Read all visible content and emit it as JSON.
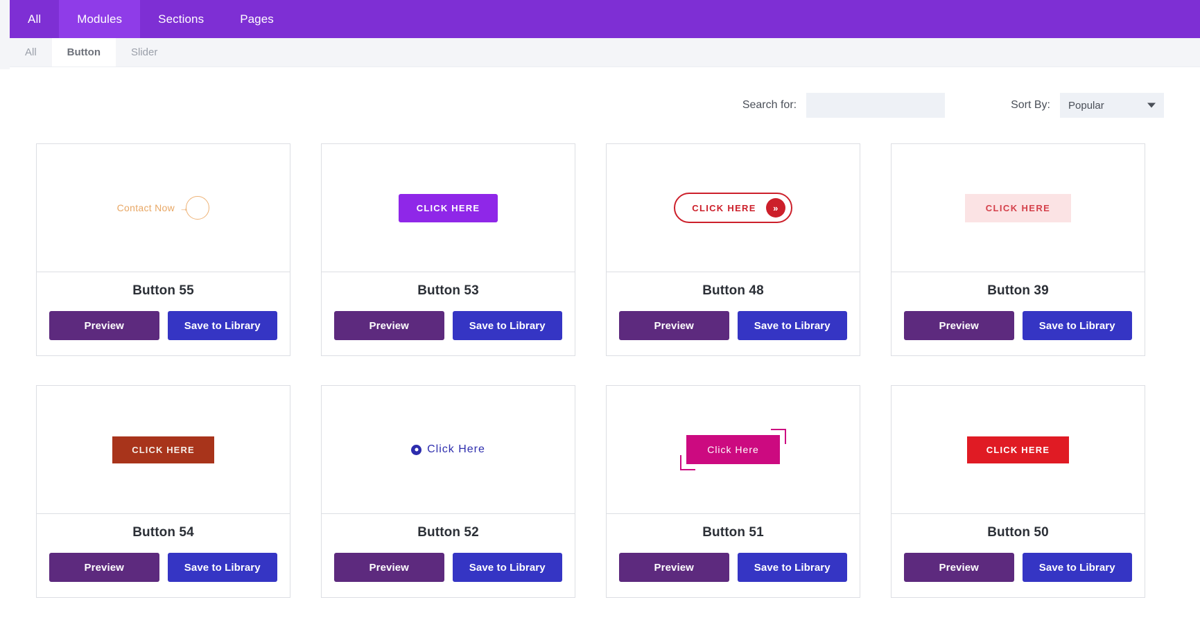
{
  "primary_nav": {
    "items": [
      {
        "label": "All",
        "active": false
      },
      {
        "label": "Modules",
        "active": true
      },
      {
        "label": "Sections",
        "active": false
      },
      {
        "label": "Pages",
        "active": false
      }
    ]
  },
  "secondary_nav": {
    "items": [
      {
        "label": "All",
        "active": false
      },
      {
        "label": "Button",
        "active": true
      },
      {
        "label": "Slider",
        "active": false
      }
    ]
  },
  "filter_bar": {
    "search_label": "Search for:",
    "search_value": "",
    "search_placeholder": "",
    "sort_label": "Sort By:",
    "sort_value": "Popular",
    "sort_options": [
      "Popular"
    ],
    "caret_icon": "chevron-down-icon"
  },
  "actions": {
    "preview_label": "Preview",
    "save_label": "Save to Library"
  },
  "colors": {
    "nav_purple": "#7e2fd4",
    "nav_purple_active": "#8f3ce8",
    "subnav_bg": "#f4f5f8",
    "preview_button": "#5d2a7e",
    "save_button": "#3535c4",
    "card_border": "#dcdee3",
    "input_bg": "#eef1f6"
  },
  "cards": [
    {
      "title": "Button 55",
      "demo_style": "contact-now-ring",
      "demo_label": "Contact Now",
      "demo_arrow": "→",
      "demo_color": "#e8a765"
    },
    {
      "title": "Button 53",
      "demo_style": "purple-solid",
      "demo_label": "CLICK HERE",
      "demo_color": "#8f27e8"
    },
    {
      "title": "Button 48",
      "demo_style": "red-pill-outline",
      "demo_label": "CLICK HERE",
      "demo_chevron": "»",
      "demo_color": "#cc1f2a"
    },
    {
      "title": "Button 39",
      "demo_style": "pink-flat",
      "demo_label": "CLICK HERE",
      "demo_color": "#d4404a"
    },
    {
      "title": "Button 54",
      "demo_style": "brick-solid",
      "demo_label": "CLICK HERE",
      "demo_color": "#a8341b"
    },
    {
      "title": "Button 52",
      "demo_style": "icon-link",
      "demo_label": "Click Here",
      "demo_icon": "circle-dot-icon",
      "demo_color": "#2d2dad"
    },
    {
      "title": "Button 51",
      "demo_style": "magenta-bracket",
      "demo_label": "Click Here",
      "demo_color": "#cc0a80"
    },
    {
      "title": "Button 50",
      "demo_style": "red-solid",
      "demo_label": "CLICK HERE",
      "demo_color": "#e01b24"
    }
  ]
}
